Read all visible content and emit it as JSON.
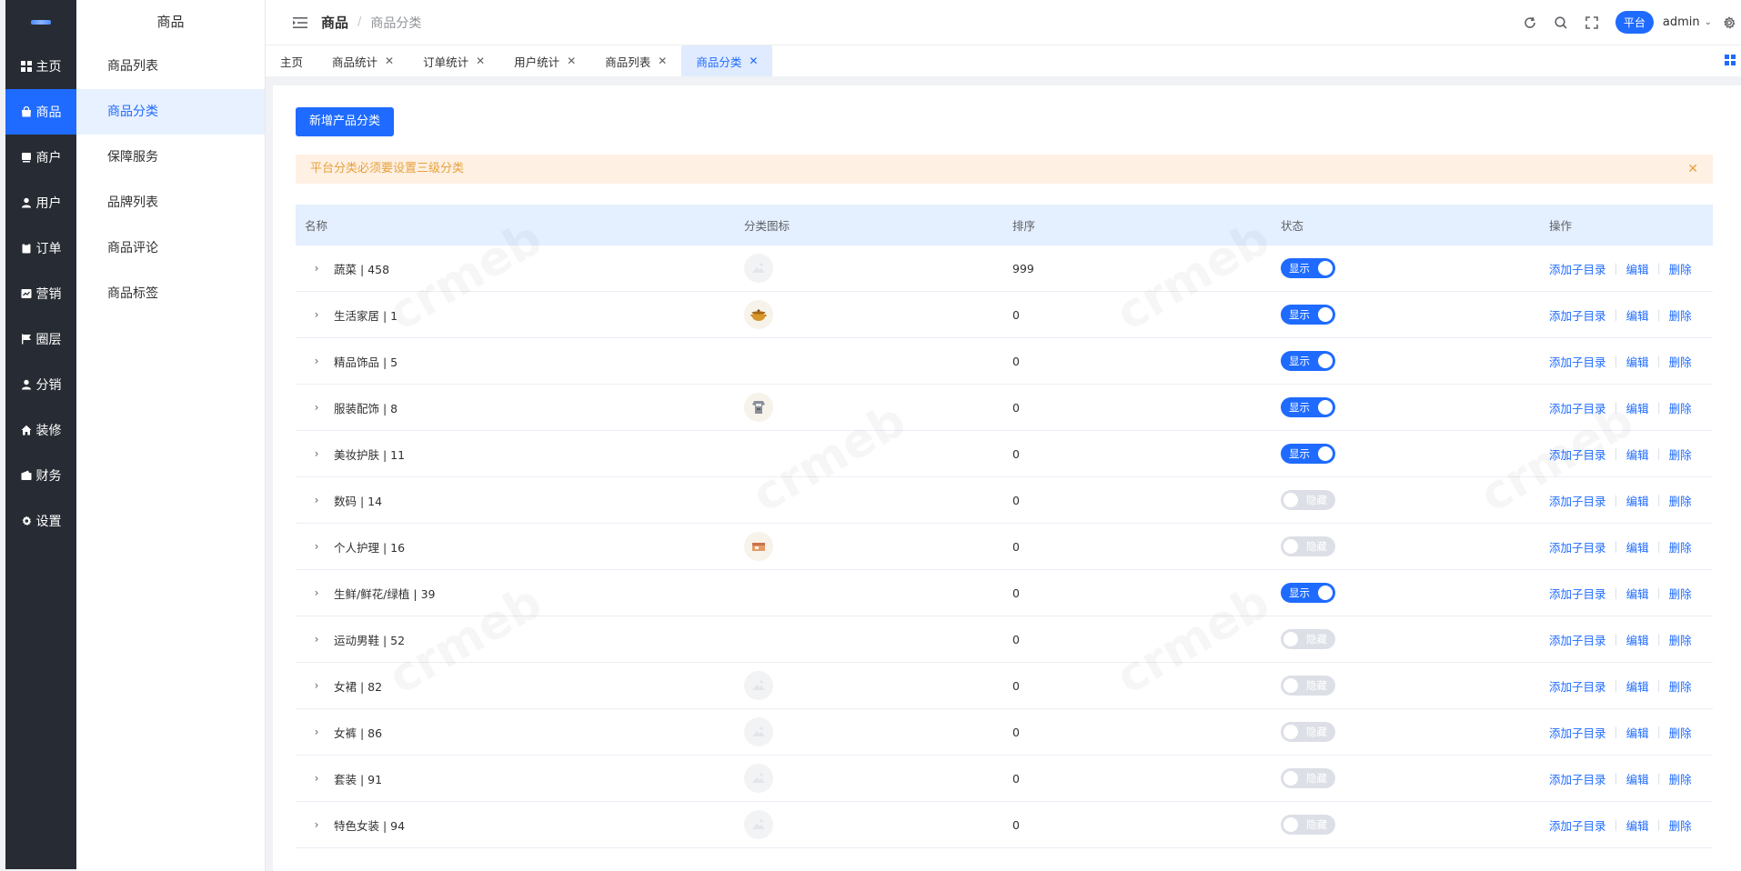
{
  "rail": {
    "items": [
      {
        "label": "主页",
        "icon": "grid-icon",
        "active": false
      },
      {
        "label": "商品",
        "icon": "bag-icon",
        "active": true
      },
      {
        "label": "商户",
        "icon": "store-icon",
        "active": false
      },
      {
        "label": "用户",
        "icon": "user-icon",
        "active": false
      },
      {
        "label": "订单",
        "icon": "clipboard-icon",
        "active": false
      },
      {
        "label": "营销",
        "icon": "chart-icon",
        "active": false
      },
      {
        "label": "圈层",
        "icon": "flag-icon",
        "active": false
      },
      {
        "label": "分销",
        "icon": "user-icon",
        "active": false
      },
      {
        "label": "装修",
        "icon": "home-icon",
        "active": false
      },
      {
        "label": "财务",
        "icon": "wallet-icon",
        "active": false
      },
      {
        "label": "设置",
        "icon": "gear-icon",
        "active": false
      }
    ]
  },
  "submenu": {
    "title": "商品",
    "items": [
      {
        "label": "商品列表",
        "active": false
      },
      {
        "label": "商品分类",
        "active": true
      },
      {
        "label": "保障服务",
        "active": false
      },
      {
        "label": "品牌列表",
        "active": false
      },
      {
        "label": "商品评论",
        "active": false
      },
      {
        "label": "商品标签",
        "active": false
      }
    ]
  },
  "header": {
    "breadcrumb_root": "商品",
    "breadcrumb_sep": "/",
    "breadcrumb_current": "商品分类",
    "platform_badge": "平台",
    "username": "admin"
  },
  "tabs": [
    {
      "label": "主页",
      "closable": false,
      "active": false
    },
    {
      "label": "商品统计",
      "closable": true,
      "active": false
    },
    {
      "label": "订单统计",
      "closable": true,
      "active": false
    },
    {
      "label": "用户统计",
      "closable": true,
      "active": false
    },
    {
      "label": "商品列表",
      "closable": true,
      "active": false
    },
    {
      "label": "商品分类",
      "closable": true,
      "active": true
    }
  ],
  "main": {
    "add_button": "新增产品分类",
    "alert": "平台分类必须要设置三级分类",
    "columns": [
      "名称",
      "分类图标",
      "排序",
      "状态",
      "操作"
    ],
    "ops": {
      "add_child": "添加子目录",
      "edit": "编辑",
      "delete": "删除"
    },
    "status_on": "显示",
    "status_off": "隐藏",
    "rows": [
      {
        "name": "蔬菜 | 458",
        "icon": "placeholder",
        "sort": "999",
        "on": true
      },
      {
        "name": "生活家居 | 1",
        "icon": "pot",
        "sort": "0",
        "on": true
      },
      {
        "name": "精品饰品 | 5",
        "icon": "none",
        "sort": "0",
        "on": true
      },
      {
        "name": "服装配饰 | 8",
        "icon": "shirt",
        "sort": "0",
        "on": true
      },
      {
        "name": "美妆护肤 | 11",
        "icon": "none",
        "sort": "0",
        "on": true
      },
      {
        "name": "数码 | 14",
        "icon": "none",
        "sort": "0",
        "on": false
      },
      {
        "name": "个人护理 | 16",
        "icon": "box",
        "sort": "0",
        "on": false
      },
      {
        "name": "生鲜/鲜花/绿植 | 39",
        "icon": "none",
        "sort": "0",
        "on": true
      },
      {
        "name": "运动男鞋 | 52",
        "icon": "none",
        "sort": "0",
        "on": false
      },
      {
        "name": "女裙 | 82",
        "icon": "placeholder",
        "sort": "0",
        "on": false
      },
      {
        "name": "女裤 | 86",
        "icon": "placeholder",
        "sort": "0",
        "on": false
      },
      {
        "name": "套装 | 91",
        "icon": "placeholder",
        "sort": "0",
        "on": false
      },
      {
        "name": "特色女装 | 94",
        "icon": "placeholder",
        "sort": "0",
        "on": false
      }
    ]
  },
  "colors": {
    "primary": "#1f6bff",
    "rail_bg": "#272b33",
    "alert_bg": "#fef0e3",
    "alert_text": "#e6a23c"
  }
}
